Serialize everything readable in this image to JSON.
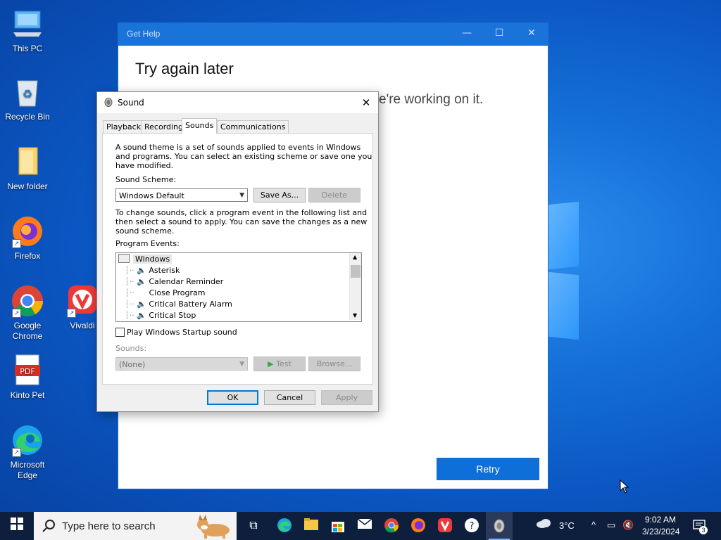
{
  "desktop": {
    "icons": [
      {
        "label": "This PC"
      },
      {
        "label": "Recycle Bin"
      },
      {
        "label": "New folder"
      },
      {
        "label": "Firefox"
      },
      {
        "label": "Google Chrome"
      },
      {
        "label": "Vivaldi"
      },
      {
        "label": "Kinto Pet"
      },
      {
        "label": "Microsoft Edge"
      }
    ]
  },
  "get_help": {
    "title": "Get Help",
    "heading": "Try again later",
    "subtext": "e're working on it.",
    "retry_label": "Retry"
  },
  "sound_dialog": {
    "title": "Sound",
    "tabs": [
      "Playback",
      "Recording",
      "Sounds",
      "Communications"
    ],
    "active_tab": "Sounds",
    "intro_lines": [
      "A sound theme is a set of sounds applied to events in Windows",
      "and programs.  You can select an existing scheme or save one you",
      "have modified."
    ],
    "scheme_label": "Sound Scheme:",
    "scheme_value": "Windows Default",
    "save_as_label": "Save As...",
    "delete_label": "Delete",
    "change_lines": [
      "To change sounds, click a program event in the following list and",
      "then select a sound to apply.  You can save the changes as a new",
      "sound scheme."
    ],
    "events_label": "Program Events:",
    "events": [
      {
        "label": "Windows",
        "has_sound": false,
        "is_group": true
      },
      {
        "label": "Asterisk",
        "has_sound": true
      },
      {
        "label": "Calendar Reminder",
        "has_sound": true
      },
      {
        "label": "Close Program",
        "has_sound": false
      },
      {
        "label": "Critical Battery Alarm",
        "has_sound": true
      },
      {
        "label": "Critical Stop",
        "has_sound": true
      }
    ],
    "startup_label": "Play Windows Startup sound",
    "sounds_label": "Sounds:",
    "sounds_value": "(None)",
    "test_label": "Test",
    "browse_label": "Browse...",
    "ok_label": "OK",
    "cancel_label": "Cancel",
    "apply_label": "Apply"
  },
  "taskbar": {
    "search_placeholder": "Type here to search",
    "weather": "3°C",
    "time": "9:02 AM",
    "date": "3/23/2024",
    "notification_count": "3"
  }
}
